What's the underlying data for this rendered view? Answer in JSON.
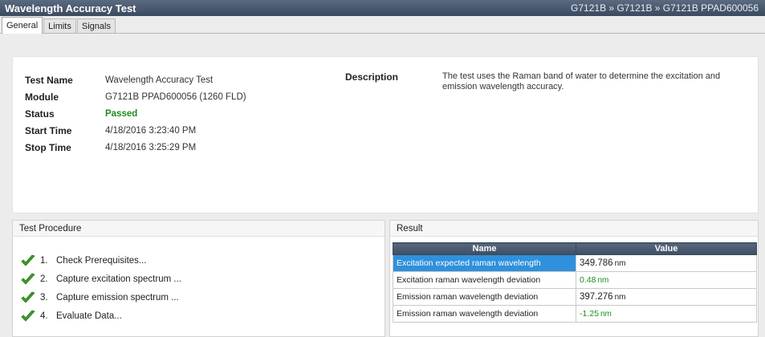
{
  "window": {
    "title": "Wavelength Accuracy Test",
    "breadcrumb": "G7121B » G7121B » G7121B PPAD600056"
  },
  "tabs": [
    {
      "label": "General",
      "active": true
    },
    {
      "label": "Limits",
      "active": false
    },
    {
      "label": "Signals",
      "active": false
    }
  ],
  "info": {
    "test_name_label": "Test Name",
    "test_name": "Wavelength Accuracy Test",
    "module_label": "Module",
    "module": "G7121B PPAD600056 (1260 FLD)",
    "status_label": "Status",
    "status": "Passed",
    "start_label": "Start Time",
    "start_time": "4/18/2016 3:23:40 PM",
    "stop_label": "Stop Time",
    "stop_time": "4/18/2016 3:25:29 PM",
    "description_label": "Description",
    "description": "The test uses the Raman band of water to determine the excitation and emission wavelength accuracy."
  },
  "procedure": {
    "header": "Test Procedure",
    "steps": [
      {
        "num": "1.",
        "label": "Check Prerequisites...",
        "icon": "check-icon"
      },
      {
        "num": "2.",
        "label": "Capture excitation spectrum ...",
        "icon": "check-icon"
      },
      {
        "num": "3.",
        "label": "Capture emission spectrum ...",
        "icon": "check-icon"
      },
      {
        "num": "4.",
        "label": "Evaluate Data...",
        "icon": "check-icon"
      }
    ]
  },
  "result": {
    "header": "Result",
    "col_name": "Name",
    "col_value": "Value",
    "rows": [
      {
        "name": "Excitation expected raman wavelength",
        "value": "349.786",
        "unit": "nm"
      },
      {
        "name": "Excitation raman wavelength deviation",
        "value": "0.48",
        "unit": "nm"
      },
      {
        "name": "Emission raman wavelength deviation",
        "value": "397.276",
        "unit": "nm"
      },
      {
        "name": "Emission raman wavelength deviation",
        "value": "-1.25",
        "unit": "nm"
      }
    ]
  },
  "colors": {
    "titlebar": "#3b4a5f",
    "passed": "#1d8c1d",
    "selection": "#2f90dc"
  }
}
